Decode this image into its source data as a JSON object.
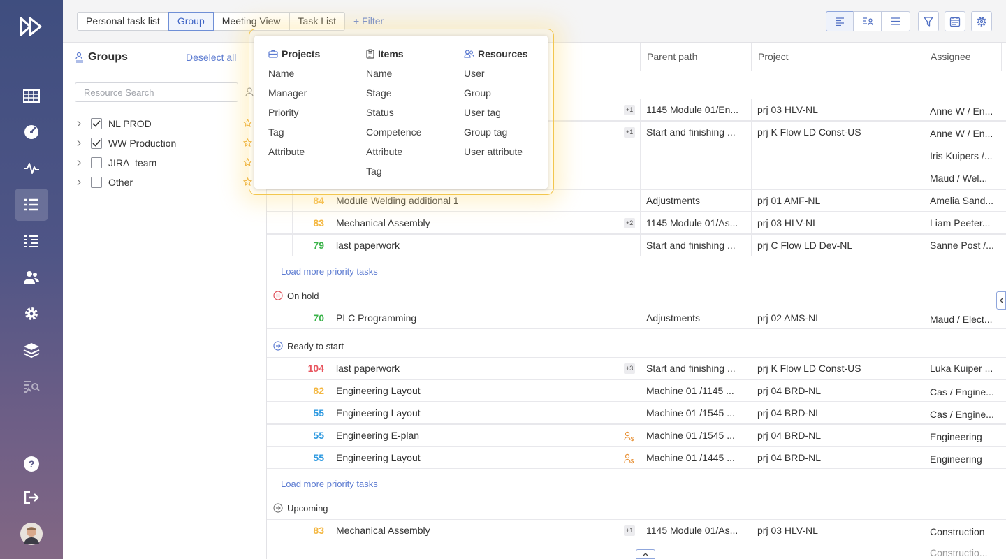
{
  "tabs": [
    "Personal task list",
    "Group",
    "Meeting View",
    "Task List"
  ],
  "filter_label": "+ Filter",
  "groups_panel": {
    "title": "Groups",
    "deselect_label": "Deselect all",
    "search_placeholder": "Resource Search",
    "items": [
      {
        "label": "NL PROD",
        "checked": true
      },
      {
        "label": "WW Production",
        "checked": true
      },
      {
        "label": "JIRA_team",
        "checked": false
      },
      {
        "label": "Other",
        "checked": false
      }
    ]
  },
  "filter_popup": {
    "columns": [
      {
        "title": "Projects",
        "icon": "briefcase-icon",
        "items": [
          "Name",
          "Manager",
          "Priority",
          "Tag",
          "Attribute"
        ]
      },
      {
        "title": "Items",
        "icon": "clipboard-icon",
        "items": [
          "Name",
          "Stage",
          "Status",
          "Competence",
          "Attribute",
          "Tag"
        ]
      },
      {
        "title": "Resources",
        "icon": "users-icon",
        "items": [
          "User",
          "Group",
          "User tag",
          "Group tag",
          "User attribute"
        ]
      }
    ]
  },
  "table": {
    "headers": {
      "parent_path": "Parent path",
      "project": "Project",
      "assignee": "Assignee"
    },
    "load_more_label": "Load more priority tasks",
    "sections": {
      "on_hold": "On hold",
      "ready": "Ready to start",
      "upcoming": "Upcoming"
    },
    "top_rows": [
      {
        "badge": "+1",
        "parent": "1145 Module 01/En...",
        "project": "prj 03 HLV-NL",
        "assignee": "Anne W / En..."
      },
      {
        "badge": "+1",
        "parent": "Start and finishing ...",
        "project": "prj K Flow LD Const-US",
        "assignee": "Anne W / En...",
        "assignee2": "Iris Kuipers /...",
        "assignee3": "Maud / Wel..."
      },
      {
        "prio": "84",
        "name": "Module Welding additional 1",
        "parent": "Adjustments",
        "project": "prj 01 AMF-NL",
        "assignee": "Amelia Sand..."
      },
      {
        "prio": "83",
        "name": "Mechanical Assembly",
        "badge": "+2",
        "parent": "1145 Module 01/As...",
        "project": "prj 03 HLV-NL",
        "assignee": "Liam Peeter..."
      },
      {
        "prio": "79",
        "name": "last paperwork",
        "parent": "Start and finishing ...",
        "project": "prj C Flow LD Dev-NL",
        "assignee": "Sanne Post /..."
      }
    ],
    "on_hold_rows": [
      {
        "prio": "70",
        "name": "PLC Programming",
        "parent": "Adjustments",
        "project": "prj 02 AMS-NL",
        "assignee": "Maud / Elect..."
      }
    ],
    "ready_rows": [
      {
        "prio": "104",
        "name": "last paperwork",
        "badge": "+3",
        "parent": "Start and finishing ...",
        "project": "prj K Flow LD Const-US",
        "assignee": "Luka Kuiper ..."
      },
      {
        "prio": "82",
        "name": "Engineering Layout",
        "parent": "Machine 01 /1145 ...",
        "project": "prj 04 BRD-NL",
        "assignee": "Cas / Engine..."
      },
      {
        "prio": "55",
        "name": "Engineering Layout",
        "parent": "Machine 01 /1545 ...",
        "project": "prj 04 BRD-NL",
        "assignee": "Cas / Engine..."
      },
      {
        "prio": "55",
        "name": "Engineering E-plan",
        "icon": "user-cost-icon",
        "parent": "Machine 01 /1545 ...",
        "project": "prj 04 BRD-NL",
        "assignee": "Engineering"
      },
      {
        "prio": "55",
        "name": "Engineering Layout",
        "icon": "user-cost-icon",
        "parent": "Machine 01 /1445 ...",
        "project": "prj 04 BRD-NL",
        "assignee": "Engineering"
      }
    ],
    "upcoming_rows": [
      {
        "prio": "83",
        "name": "Mechanical Assembly",
        "badge": "+1",
        "parent": "1145 Module 01/As...",
        "project": "prj 03 HLV-NL",
        "assignee": "Construction",
        "assignee2": "Constructio..."
      }
    ]
  },
  "colors": {
    "accent": "#5c7bd1",
    "prio_red": "#e8555f",
    "prio_yellow": "#f4b740",
    "prio_green": "#3bb34a",
    "prio_blue": "#2f9ae0"
  }
}
